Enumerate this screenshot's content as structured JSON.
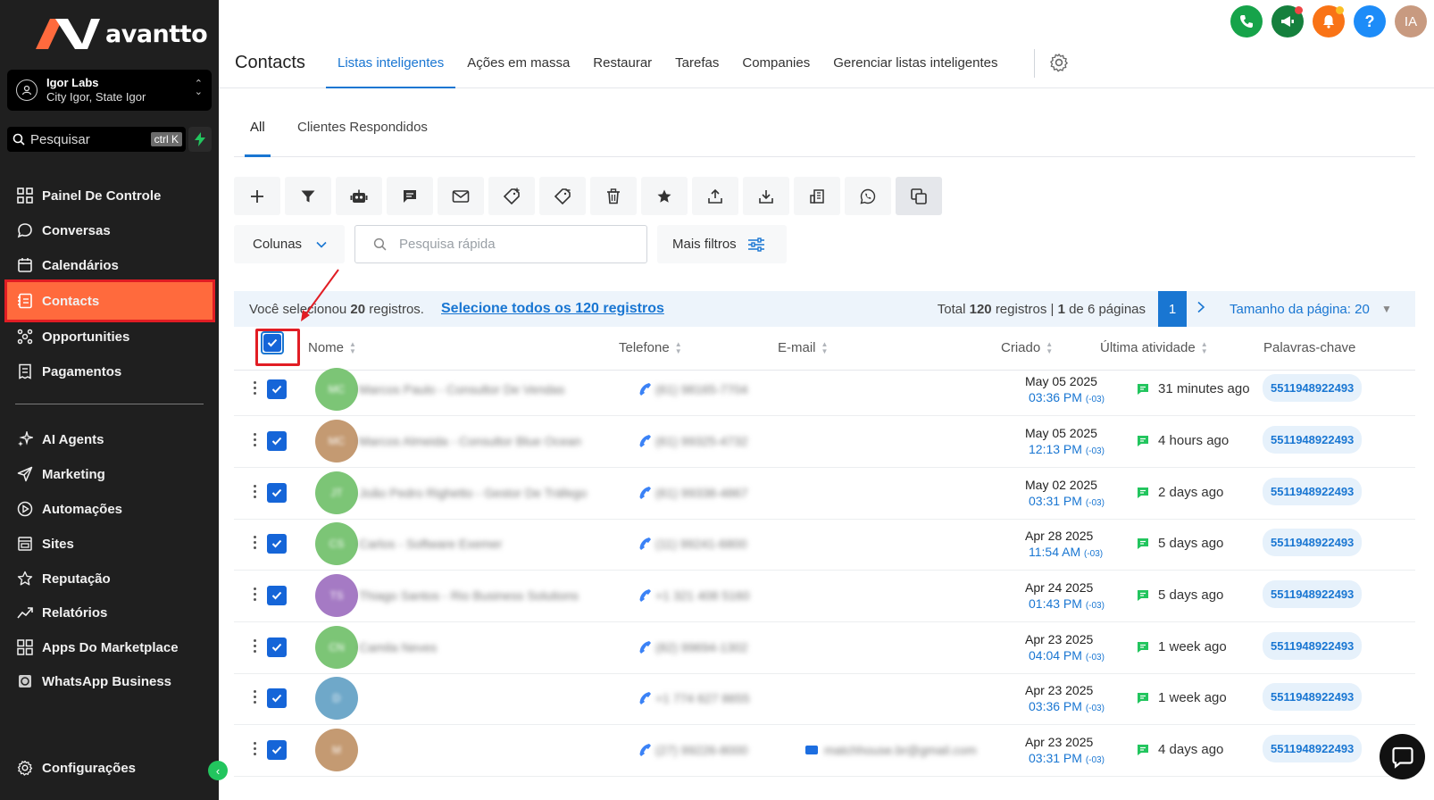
{
  "brand": {
    "name": "avantto",
    "accent": "#ff6a3d",
    "sidebar_bg": "#1f1f1f"
  },
  "account": {
    "name": "Igor Labs",
    "location": "City Igor, State Igor"
  },
  "search": {
    "placeholder": "Pesquisar",
    "shortcut": "ctrl K"
  },
  "sidebar": {
    "items": [
      {
        "label": "Painel De Controle",
        "icon": "dashboard-icon"
      },
      {
        "label": "Conversas",
        "icon": "chat-icon"
      },
      {
        "label": "Calendários",
        "icon": "calendar-icon"
      },
      {
        "label": "Contacts",
        "icon": "contacts-icon",
        "active": true
      },
      {
        "label": "Opportunities",
        "icon": "opportunities-icon"
      },
      {
        "label": "Pagamentos",
        "icon": "payments-icon"
      },
      {
        "label": "AI Agents",
        "icon": "ai-agents-icon"
      },
      {
        "label": "Marketing",
        "icon": "send-icon"
      },
      {
        "label": "Automações",
        "icon": "automation-icon"
      },
      {
        "label": "Sites",
        "icon": "sites-icon"
      },
      {
        "label": "Reputação",
        "icon": "star-icon"
      },
      {
        "label": "Relatórios",
        "icon": "reports-icon"
      },
      {
        "label": "Apps Do Marketplace",
        "icon": "apps-icon"
      },
      {
        "label": "WhatsApp Business",
        "icon": "whatsapp-icon"
      }
    ],
    "settings": "Configurações"
  },
  "user_initials": "IA",
  "header": {
    "title": "Contacts",
    "tabs": [
      "Listas inteligentes",
      "Ações em massa",
      "Restaurar",
      "Tarefas",
      "Companies",
      "Gerenciar listas inteligentes"
    ]
  },
  "subtabs": [
    "All",
    "Clientes Respondidos"
  ],
  "toolbar": {
    "icons": [
      "add-icon",
      "filter-icon",
      "robot-icon",
      "message-icon",
      "email-icon",
      "add-tag-icon",
      "remove-tag-icon",
      "delete-icon",
      "star-icon",
      "export-icon",
      "import-icon",
      "company-icon",
      "whatsapp-icon",
      "duplicate-icon"
    ]
  },
  "filters": {
    "columns": "Colunas",
    "quick_search_placeholder": "Pesquisa rápida",
    "more_filters": "Mais filtros"
  },
  "selection": {
    "prefix": "Você selecionou",
    "count": "20",
    "suffix": "registros.",
    "select_all_link": "Selecione todos os 120 registros",
    "total_prefix": "Total",
    "total": "120",
    "total_mid": "registros |",
    "page": "1",
    "page_suffix": "de 6 páginas",
    "current_page": "1",
    "page_size": "Tamanho da página: 20"
  },
  "table": {
    "columns": [
      "Nome",
      "Telefone",
      "E-mail",
      "Criado",
      "Última atividade",
      "Palavras-chave"
    ],
    "rows": [
      {
        "initials": "MC",
        "avatar_color": "#7cc576",
        "name": "Marcos Paulo - Consultor De Vendas",
        "phone": "(61) 98165-7704",
        "email": "",
        "date": "May 05 2025",
        "time": "03:36 PM",
        "tz": "(-03)",
        "activity": "31 minutes ago",
        "tag": "5511948922493"
      },
      {
        "initials": "MC",
        "avatar_color": "#c49a72",
        "name": "Marcos Almeida - Consultor Blue Ocean",
        "phone": "(61) 99325-4732",
        "email": "",
        "date": "May 05 2025",
        "time": "12:13 PM",
        "tz": "(-03)",
        "activity": "4 hours ago",
        "tag": "5511948922493"
      },
      {
        "initials": "JT",
        "avatar_color": "#7cc576",
        "name": "João Pedro Righetto - Gestor De Tráfego",
        "phone": "(61) 99338-4867",
        "email": "",
        "date": "May 02 2025",
        "time": "03:31 PM",
        "tz": "(-03)",
        "activity": "2 days ago",
        "tag": "5511948922493"
      },
      {
        "initials": "CS",
        "avatar_color": "#7cc576",
        "name": "Carlos - Software Exemer",
        "phone": "(11) 99241-6800",
        "email": "",
        "date": "Apr 28 2025",
        "time": "11:54 AM",
        "tz": "(-03)",
        "activity": "5 days ago",
        "tag": "5511948922493"
      },
      {
        "initials": "TS",
        "avatar_color": "#a57ac4",
        "name": "Thiago Santos - Rio Business Solutions",
        "phone": "+1 321 408 5160",
        "email": "",
        "date": "Apr 24 2025",
        "time": "01:43 PM",
        "tz": "(-03)",
        "activity": "5 days ago",
        "tag": "5511948922493"
      },
      {
        "initials": "CN",
        "avatar_color": "#7cc576",
        "name": "Camila Neves",
        "phone": "(82) 99694-1302",
        "email": "",
        "date": "Apr 23 2025",
        "time": "04:04 PM",
        "tz": "(-03)",
        "activity": "1 week ago",
        "tag": "5511948922493"
      },
      {
        "initials": "D",
        "avatar_color": "#6fa8c9",
        "name": "",
        "phone": "+1 774 627 8655",
        "email": "",
        "date": "Apr 23 2025",
        "time": "03:36 PM",
        "tz": "(-03)",
        "activity": "1 week ago",
        "tag": "5511948922493"
      },
      {
        "initials": "M",
        "avatar_color": "#c49a72",
        "name": "",
        "phone": "(27) 99226-8000",
        "email": "matchhouse.br@gmail.com",
        "date": "Apr 23 2025",
        "time": "03:31 PM",
        "tz": "(-03)",
        "activity": "4 days ago",
        "tag": "5511948922493"
      }
    ]
  }
}
